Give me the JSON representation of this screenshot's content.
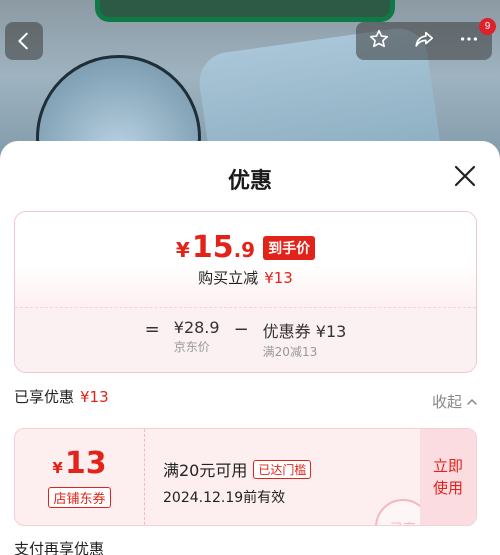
{
  "background": {
    "colors": {
      "accent": "#e2231a",
      "brand_green": "#0f7a46"
    },
    "cart_badge": "9",
    "icons": [
      "back-arrow-icon",
      "star-icon",
      "share-icon",
      "more-dots-icon"
    ]
  },
  "sheet": {
    "title": "优惠",
    "summary": {
      "final_yen": "¥",
      "final_int": "15",
      "final_dec": ".9",
      "final_tag": "到手价",
      "reduce_label": "购买立减",
      "reduce_amount": "¥13",
      "equals": "=",
      "jd_price": "¥28.9",
      "jd_price_label": "京东价",
      "minus": "−",
      "coupon_value": "优惠券 ¥13",
      "coupon_rule": "满20减13"
    },
    "enjoy_label": "已享优惠",
    "enjoy_amount": "¥13",
    "collapse_label": "收起",
    "coupon": {
      "yen": "¥",
      "amount": "13",
      "type": "店铺东券",
      "condition": "满20元可用",
      "reached": "已达门槛",
      "valid": "2024.12.19前有效",
      "use_label": "立即使用",
      "stamp": "已享"
    },
    "pay_title": "支付再享优惠"
  }
}
